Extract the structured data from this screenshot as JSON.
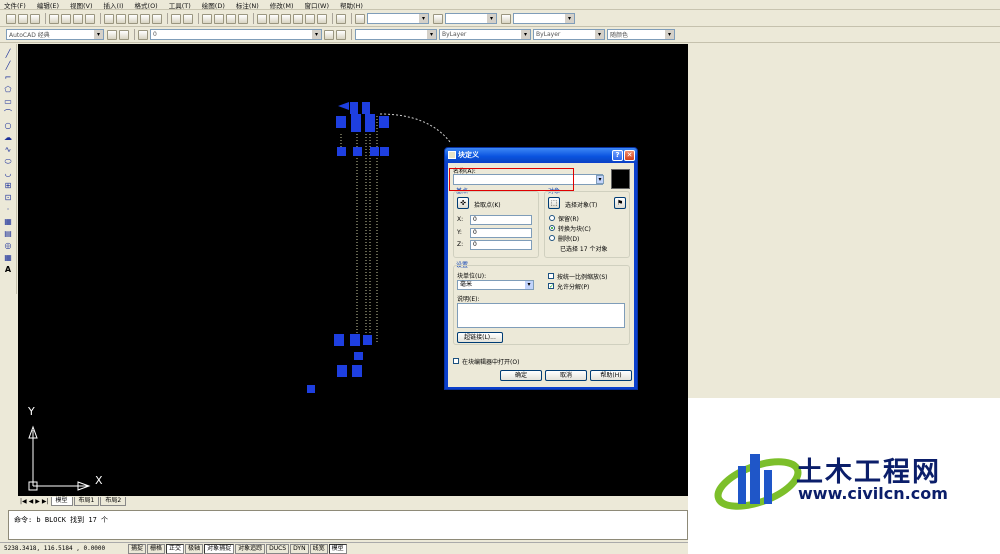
{
  "menu": [
    "文件(F)",
    "编辑(E)",
    "视图(V)",
    "插入(I)",
    "格式(O)",
    "工具(T)",
    "绘图(D)",
    "标注(N)",
    "修改(M)",
    "窗口(W)",
    "帮助(H)"
  ],
  "toolbar2": {
    "workspace": "AutoCAD 经典",
    "layer": "0",
    "linetype": "ByLayer",
    "lineweight": "ByLayer",
    "color": "随颜色"
  },
  "tabs": [
    "模型",
    "布局1",
    "布局2"
  ],
  "command": {
    "line": "命令: b BLOCK 找到 17 个"
  },
  "status": {
    "coords": "5238.3418, 116.5184 , 0.0000",
    "buttons": [
      "捕捉",
      "栅格",
      "正交",
      "极轴",
      "对象捕捉",
      "对象追踪",
      "DUCS",
      "DYN",
      "线宽",
      "模型"
    ]
  },
  "axis": {
    "x": "X",
    "y": "Y"
  },
  "dialog": {
    "title": "块定义",
    "name_label": "名称(A):",
    "name_value": "",
    "base_group": "基点",
    "pick_point": "拾取点(K)",
    "x_label": "X:",
    "x_value": "0",
    "y_label": "Y:",
    "y_value": "0",
    "z_label": "Z:",
    "z_value": "0",
    "objects_group": "对象",
    "select_objects": "选择对象(T)",
    "retain": "保留(R)",
    "convert": "转换为块(C)",
    "delete": "删除(D)",
    "selected_count": "已选择 17 个对象",
    "settings_group": "设置",
    "block_unit_label": "块单位(U):",
    "block_unit_value": "毫米",
    "scale_uniformly": "按统一比例缩放(S)",
    "allow_explode": "允许分解(P)",
    "description_label": "说明(E):",
    "hyperlink": "超链接(L)...",
    "open_in_editor": "在块编辑器中打开(O)",
    "ok": "确定",
    "cancel": "取消",
    "help": "帮助(H)"
  },
  "watermark": {
    "title": "土木工程网",
    "url": "www.civilcn.com"
  }
}
